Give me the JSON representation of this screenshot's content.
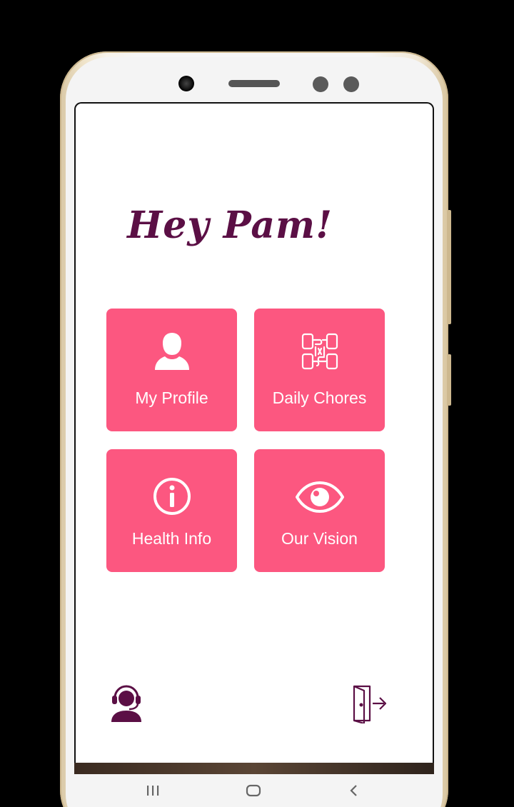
{
  "greeting": "Hey Pam!",
  "tiles": [
    {
      "label": "My Profile",
      "icon": "woman-user-icon"
    },
    {
      "label": "Daily Chores",
      "icon": "joined-hands-icon"
    },
    {
      "label": "Health Info",
      "icon": "info-circle-icon"
    },
    {
      "label": "Our Vision",
      "icon": "eye-icon"
    }
  ],
  "bottom_bar": {
    "left_icon": "support-agent-icon",
    "right_icon": "logout-door-icon"
  },
  "system_nav": {
    "recents": "recents-icon",
    "home": "home-icon",
    "back": "back-icon"
  },
  "colors": {
    "tile": "#fc5780",
    "accent": "#5b0f45",
    "screen_bg": "#ffffff"
  }
}
